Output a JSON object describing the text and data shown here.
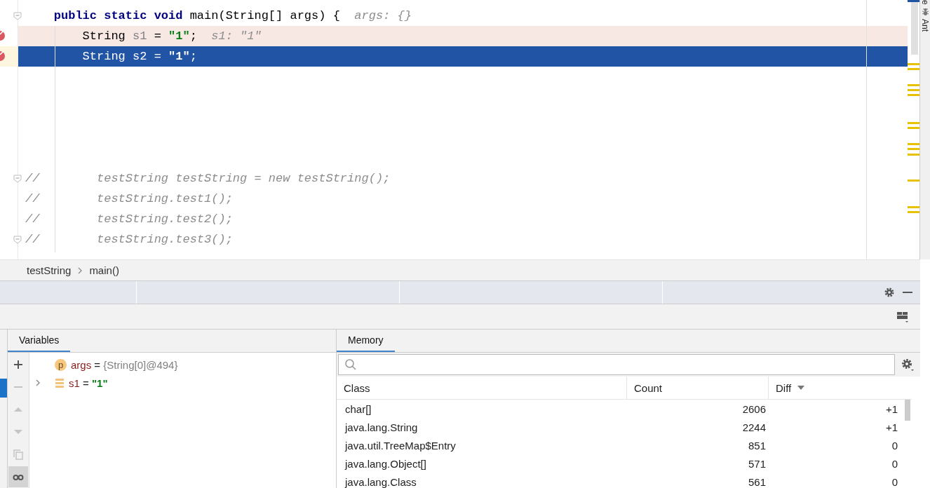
{
  "editor": {
    "lines": [
      {
        "kind": "code",
        "breakpoint": false,
        "fold": true,
        "executed": false,
        "selected": false,
        "tokens": [
          {
            "text": "    public static void",
            "kind": "keyword"
          },
          {
            "text": " main(String[] args) {",
            "kind": "plain"
          },
          {
            "text": "  args: {}",
            "kind": "hint"
          }
        ]
      },
      {
        "kind": "code",
        "breakpoint": true,
        "fold": false,
        "executed": true,
        "selected": false,
        "tokens": [
          {
            "text": "        String ",
            "kind": "plain"
          },
          {
            "text": "s1",
            "kind": "unused"
          },
          {
            "text": " = ",
            "kind": "plain"
          },
          {
            "text": "\"1\"",
            "kind": "string"
          },
          {
            "text": ";",
            "kind": "plain"
          },
          {
            "text": "  s1: \"1\"",
            "kind": "hint"
          }
        ]
      },
      {
        "kind": "code",
        "breakpoint": true,
        "fold": false,
        "executed": false,
        "selected": true,
        "tokens": [
          {
            "text": "        String s2 = ",
            "kind": "plain"
          },
          {
            "text": "\"1\"",
            "kind": "string"
          },
          {
            "text": ";",
            "kind": "plain"
          }
        ]
      },
      {
        "kind": "blank"
      },
      {
        "kind": "blank"
      },
      {
        "kind": "blank"
      },
      {
        "kind": "blank"
      },
      {
        "kind": "blank"
      },
      {
        "kind": "code",
        "breakpoint": false,
        "fold": true,
        "executed": false,
        "selected": false,
        "tokens": [
          {
            "text": "//        testString testString = new testString();",
            "kind": "comment"
          }
        ]
      },
      {
        "kind": "code",
        "breakpoint": false,
        "fold": false,
        "executed": false,
        "selected": false,
        "tokens": [
          {
            "text": "//        testString.test1();",
            "kind": "comment"
          }
        ]
      },
      {
        "kind": "code",
        "breakpoint": false,
        "fold": false,
        "executed": false,
        "selected": false,
        "tokens": [
          {
            "text": "//        testString.test2();",
            "kind": "comment"
          }
        ]
      },
      {
        "kind": "code",
        "breakpoint": false,
        "fold": true,
        "executed": false,
        "selected": false,
        "tokens": [
          {
            "text": "//        testString.test3();",
            "kind": "comment"
          }
        ]
      }
    ]
  },
  "right_strip": {
    "items": [
      {
        "label": "e",
        "icon": false
      },
      {
        "label": "Ant",
        "icon": true
      }
    ]
  },
  "breadcrumb": [
    "testString",
    "main()"
  ],
  "variables": {
    "tab": {
      "label": "Variables",
      "selected": true
    },
    "toolbar": [
      {
        "kind": "add",
        "disabled": false,
        "selected": false
      },
      {
        "kind": "remove",
        "disabled": true,
        "selected": false
      },
      {
        "kind": "up",
        "disabled": true,
        "selected": false
      },
      {
        "kind": "down",
        "disabled": true,
        "selected": false
      },
      {
        "kind": "copy",
        "disabled": true,
        "selected": false
      },
      {
        "kind": "glasses",
        "disabled": false,
        "selected": true
      }
    ],
    "items": [
      {
        "badge": "p",
        "kind": "parameter",
        "name": "args",
        "operator": "=",
        "value": "{String[0]@494}"
      },
      {
        "kind": "field",
        "name": "s1",
        "operator": "=",
        "value": "\"1\"",
        "expanded": false
      }
    ]
  },
  "memory": {
    "tab": {
      "label": "Memory",
      "selected": true
    },
    "columns": [
      {
        "label": "Class",
        "sorted": false
      },
      {
        "label": "Count",
        "sorted": false
      },
      {
        "label": "Diff",
        "sorted": true
      }
    ],
    "rows": [
      [
        "char[]",
        "2606",
        "+1"
      ],
      [
        "java.lang.String",
        "2244",
        "+1"
      ],
      [
        "java.util.TreeMap$Entry",
        "851",
        "0"
      ],
      [
        "java.lang.Object[]",
        "571",
        "0"
      ],
      [
        "java.lang.Class",
        "561",
        "0"
      ]
    ]
  }
}
